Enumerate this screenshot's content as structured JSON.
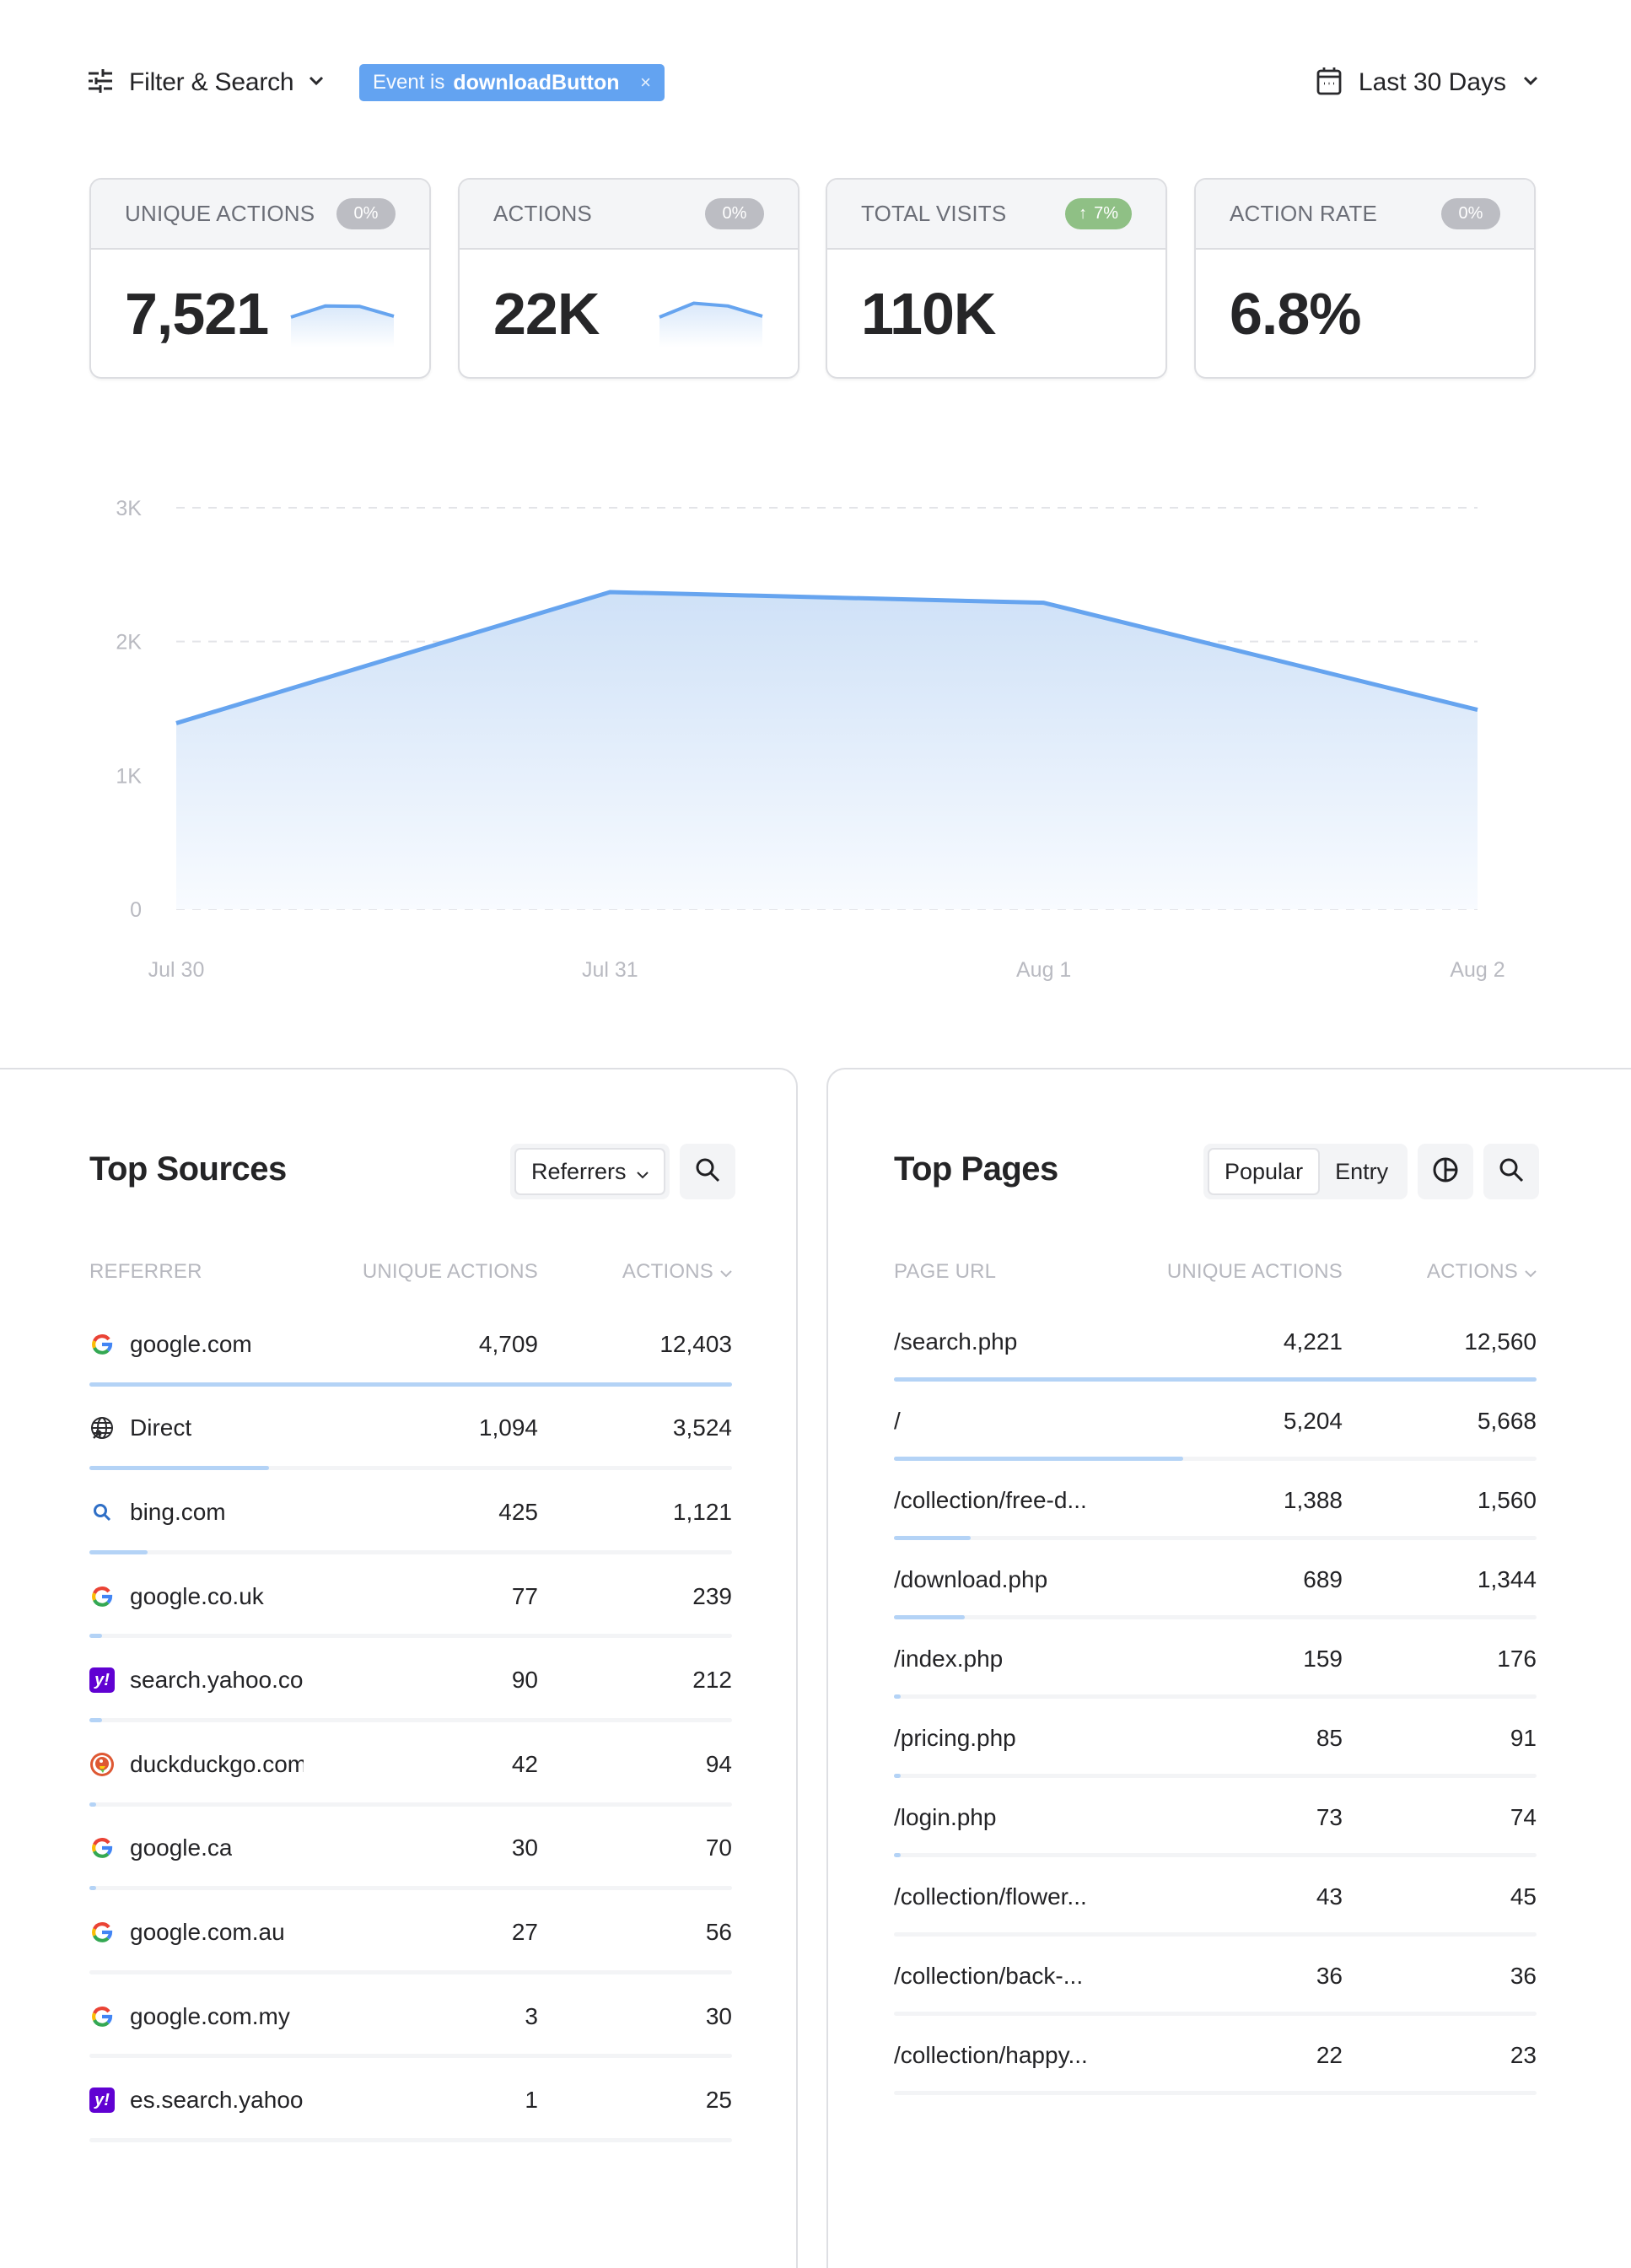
{
  "toolbar": {
    "filter_label": "Filter & Search",
    "filter_icon": "sliders-icon",
    "chip_key": "Event is",
    "chip_value": "downloadButton",
    "chip_close": "×",
    "date_label": "Last 30 Days",
    "date_icon": "calendar-icon"
  },
  "metrics": [
    {
      "title": "UNIQUE ACTIONS",
      "change": "0%",
      "trend": "neutral",
      "value": "7,521",
      "sparkline": [
        1.0,
        1.6,
        1.58,
        1.05
      ]
    },
    {
      "title": "ACTIONS",
      "change": "0%",
      "trend": "neutral",
      "value": "22K",
      "sparkline": [
        1.0,
        1.75,
        1.6,
        1.05
      ]
    },
    {
      "title": "TOTAL VISITS",
      "change": "7%",
      "trend": "up",
      "value": "110K",
      "sparkline": null
    },
    {
      "title": "ACTION RATE",
      "change": "0%",
      "trend": "neutral",
      "value": "6.8%",
      "sparkline": null
    }
  ],
  "colors": {
    "accent": "#63a3f1",
    "line": "#66a4ef",
    "bar_fill": "#b4d3f6",
    "pill_neutral": "#bcbdc3",
    "pill_up": "#8fc085",
    "yahoo": "#6001d2"
  },
  "chart_data": {
    "type": "area",
    "title": "",
    "xlabel": "",
    "ylabel": "",
    "categories": [
      "Jul 30",
      "Jul 31",
      "Aug 1",
      "Aug 2"
    ],
    "series": [
      {
        "name": "Actions",
        "values": [
          1390,
          2370,
          2290,
          1490
        ]
      }
    ],
    "ylim": [
      0,
      3000
    ],
    "yticks": [
      {
        "value": 0,
        "label": "0"
      },
      {
        "value": 1000,
        "label": "1K"
      },
      {
        "value": 2000,
        "label": "2K"
      },
      {
        "value": 3000,
        "label": "3K"
      }
    ],
    "grid": true,
    "legend": "none"
  },
  "sources": {
    "title": "Top Sources",
    "selector": "Referrers",
    "columns": [
      "REFERRER",
      "UNIQUE ACTIONS",
      "ACTIONS"
    ],
    "rows": [
      {
        "icon": "google",
        "name": "google.com",
        "unique": "4,709",
        "actions": "12,403",
        "share": 1.0
      },
      {
        "icon": "globe",
        "name": "Direct",
        "unique": "1,094",
        "actions": "3,524",
        "share": 0.28
      },
      {
        "icon": "bing",
        "name": "bing.com",
        "unique": "425",
        "actions": "1,121",
        "share": 0.09
      },
      {
        "icon": "google",
        "name": "google.co.uk",
        "unique": "77",
        "actions": "239",
        "share": 0.02
      },
      {
        "icon": "yahoo",
        "name": "search.yahoo.com",
        "unique": "90",
        "actions": "212",
        "share": 0.02
      },
      {
        "icon": "duckduckgo",
        "name": "duckduckgo.com",
        "unique": "42",
        "actions": "94",
        "share": 0.008
      },
      {
        "icon": "google",
        "name": "google.ca",
        "unique": "30",
        "actions": "70",
        "share": 0.006
      },
      {
        "icon": "google",
        "name": "google.com.au",
        "unique": "27",
        "actions": "56",
        "share": 0.0
      },
      {
        "icon": "google",
        "name": "google.com.my",
        "unique": "3",
        "actions": "30",
        "share": 0.0
      },
      {
        "icon": "yahoo",
        "name": "es.search.yahoo.com",
        "unique": "1",
        "actions": "25",
        "share": 0.0
      }
    ]
  },
  "pages": {
    "title": "Top Pages",
    "tabs": [
      "Popular",
      "Entry"
    ],
    "active_tab": "Popular",
    "columns": [
      "PAGE URL",
      "UNIQUE ACTIONS",
      "ACTIONS"
    ],
    "rows": [
      {
        "url": "/search.php",
        "unique": "4,221",
        "actions": "12,560",
        "share": 1.0
      },
      {
        "url": "/",
        "unique": "5,204",
        "actions": "5,668",
        "share": 0.45
      },
      {
        "url": "/collection/free-d...",
        "unique": "1,388",
        "actions": "1,560",
        "share": 0.12
      },
      {
        "url": "/download.php",
        "unique": "689",
        "actions": "1,344",
        "share": 0.11
      },
      {
        "url": "/index.php",
        "unique": "159",
        "actions": "176",
        "share": 0.01
      },
      {
        "url": "/pricing.php",
        "unique": "85",
        "actions": "91",
        "share": 0.01
      },
      {
        "url": "/login.php",
        "unique": "73",
        "actions": "74",
        "share": 0.01
      },
      {
        "url": "/collection/flower...",
        "unique": "43",
        "actions": "45",
        "share": 0.0
      },
      {
        "url": "/collection/back-...",
        "unique": "36",
        "actions": "36",
        "share": 0.0
      },
      {
        "url": "/collection/happy...",
        "unique": "22",
        "actions": "23",
        "share": 0.0
      }
    ]
  }
}
